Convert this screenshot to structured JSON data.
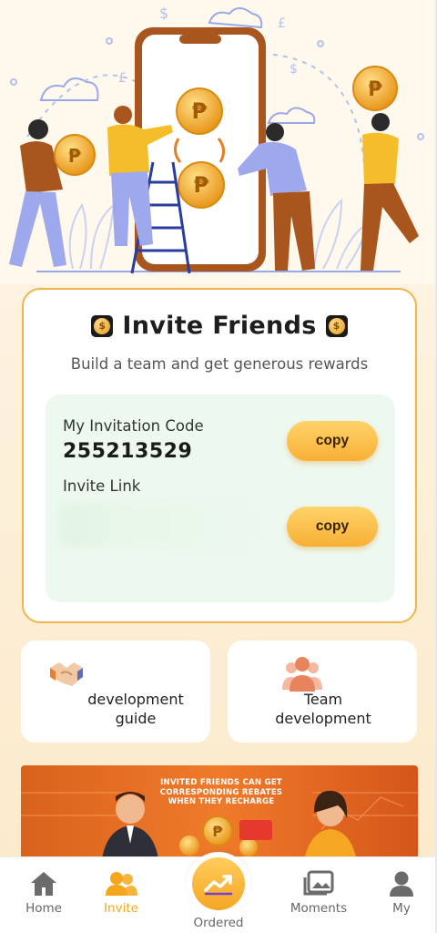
{
  "invite": {
    "title": "Invite Friends",
    "subtitle": "Build a team and get generous rewards",
    "code_label": "My Invitation Code",
    "code_value": "255213529",
    "link_label": "Invite Link",
    "copy_label": "copy"
  },
  "tiles": {
    "guide": "development guide",
    "team": "Team development"
  },
  "banner": {
    "text": "INVITED FRIENDS CAN GET CORRESPONDING REBATES WHEN THEY RECHARGE"
  },
  "tabbar": {
    "home": "Home",
    "invite": "Invite",
    "ordered": "Ordered",
    "moments": "Moments",
    "my": "My",
    "active": "Invite"
  },
  "colors": {
    "accent": "#f4a71d",
    "card_border": "#f1b54c",
    "code_bg": "#edf8ef"
  }
}
